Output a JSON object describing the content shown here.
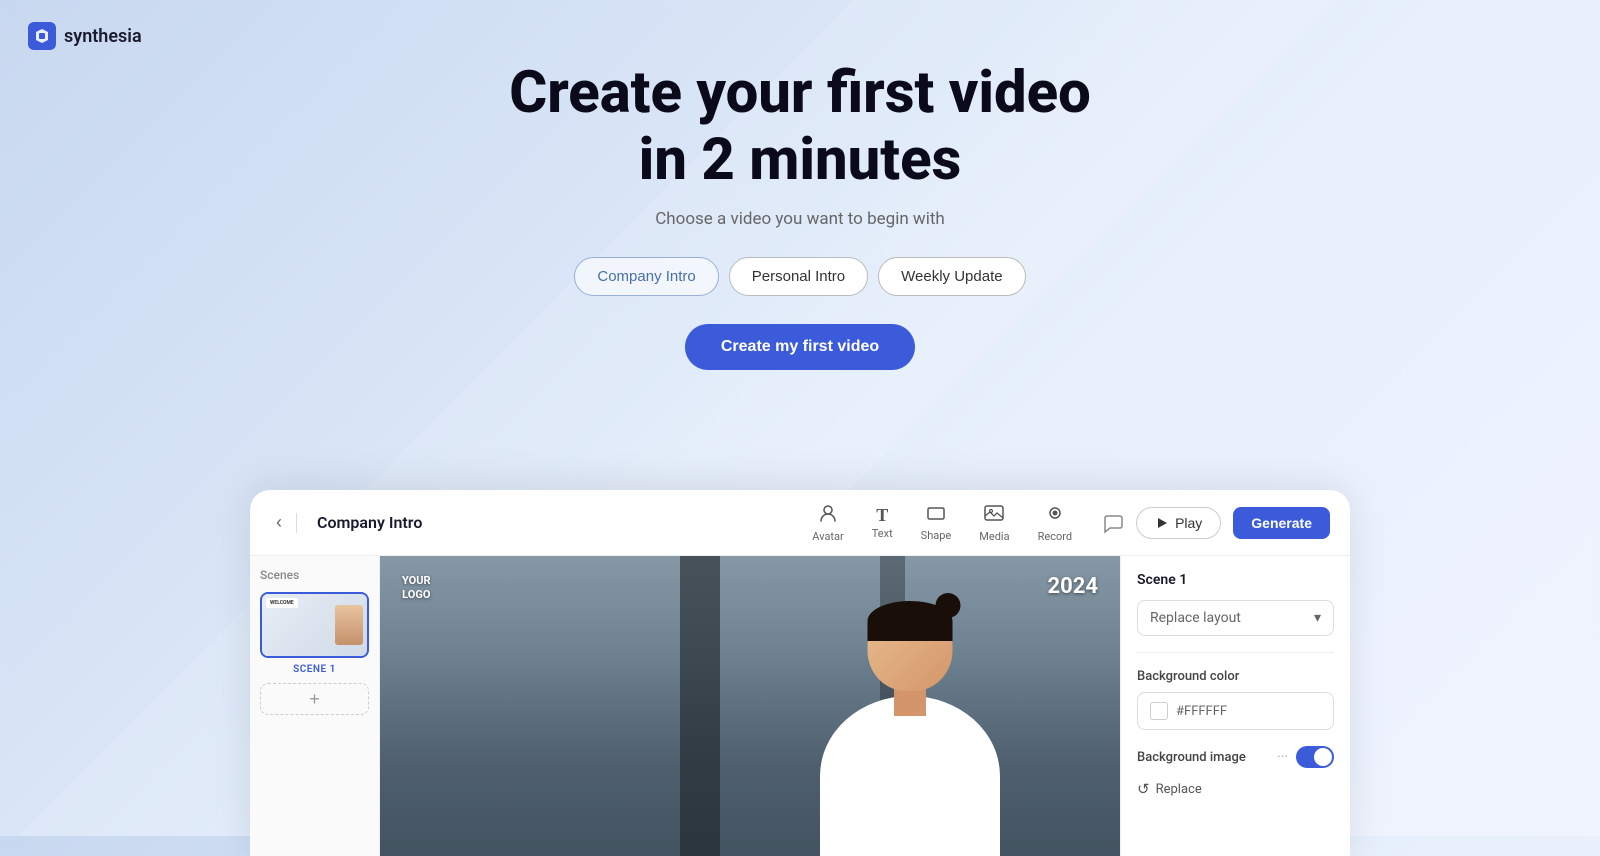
{
  "logo": {
    "text": "synthesia"
  },
  "hero": {
    "title_line1": "Create your first video",
    "title_line2": "in 2 minutes",
    "subtitle": "Choose a video you want to begin with",
    "cta_label": "Create my first video"
  },
  "tabs": [
    {
      "id": "company-intro",
      "label": "Company Intro",
      "active": true
    },
    {
      "id": "personal-intro",
      "label": "Personal Intro",
      "active": false
    },
    {
      "id": "weekly-update",
      "label": "Weekly Update",
      "active": false
    }
  ],
  "editor": {
    "title": "Company Intro",
    "tools": [
      {
        "id": "avatar",
        "label": "Avatar",
        "icon": "👤"
      },
      {
        "id": "text",
        "label": "Text",
        "icon": "T"
      },
      {
        "id": "shape",
        "label": "Shape",
        "icon": "⬜"
      },
      {
        "id": "media",
        "label": "Media",
        "icon": "🖼"
      },
      {
        "id": "record",
        "label": "Record",
        "icon": "⏺"
      }
    ],
    "play_label": "Play",
    "generate_label": "Generate",
    "scenes_label": "Scenes",
    "scene_name": "SCENE 1",
    "canvas": {
      "logo_line1": "YOUR",
      "logo_line2": "LOGO",
      "year": "2024"
    },
    "right_panel": {
      "section_title": "Scene 1",
      "replace_layout_label": "Replace layout",
      "bg_color_label": "Background color",
      "bg_color_value": "#FFFFFF",
      "bg_image_label": "Background image",
      "replace_label": "Replace"
    }
  }
}
